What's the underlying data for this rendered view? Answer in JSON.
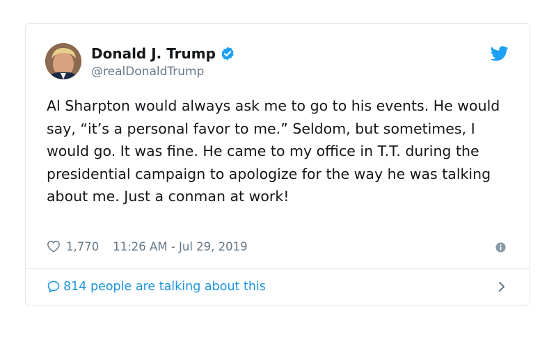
{
  "author": {
    "display_name": "Donald J. Trump",
    "handle": "@realDonaldTrump",
    "verified_icon": "verified-badge-icon",
    "avatar": "profile-photo"
  },
  "tweet": {
    "text": "Al Sharpton would always ask me to go to his events. He would say, “it’s a personal favor to me.” Seldom, but sometimes, I would go. It was fine. He came to my office in T.T. during the presidential campaign to apologize for the way he was talking about me. Just a conman at work!"
  },
  "meta": {
    "like_icon": "heart-icon",
    "likes": "1,770",
    "timestamp": "11:26 AM - Jul 29, 2019",
    "info_icon": "info-icon"
  },
  "footer": {
    "talk_icon": "speech-bubble-icon",
    "talk_text": "814 people are talking about this",
    "chevron_icon": "chevron-right-icon"
  },
  "colors": {
    "twitter_blue": "#1da1f2",
    "link_blue": "#1b95e0",
    "text": "#14171a",
    "secondary_text": "#657786",
    "border": "#e1e8ed"
  }
}
